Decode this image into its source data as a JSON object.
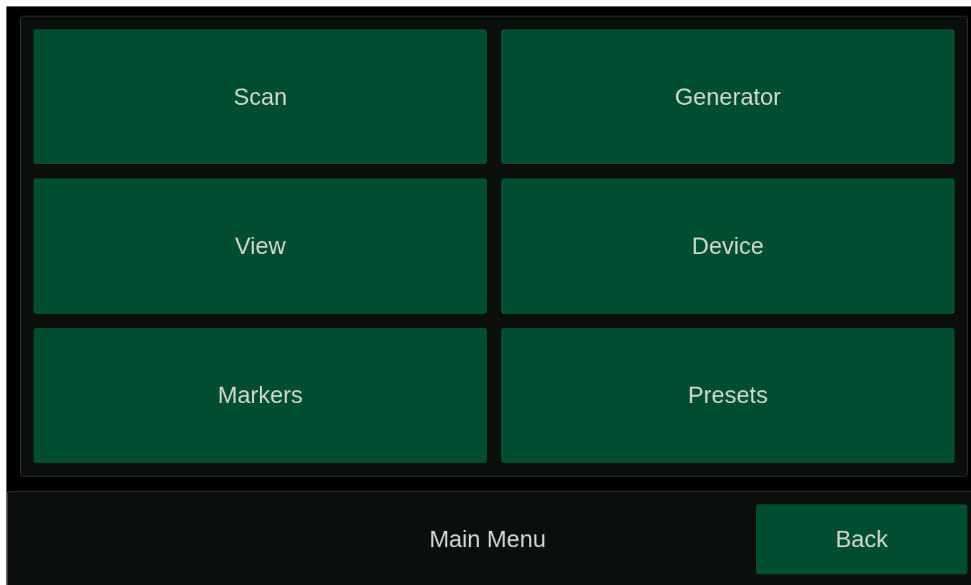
{
  "menu_buttons": [
    {
      "label": "Scan"
    },
    {
      "label": "Generator"
    },
    {
      "label": "View"
    },
    {
      "label": "Device"
    },
    {
      "label": "Markers"
    },
    {
      "label": "Presets"
    }
  ],
  "footer": {
    "title": "Main Menu",
    "back_button": "Back"
  }
}
